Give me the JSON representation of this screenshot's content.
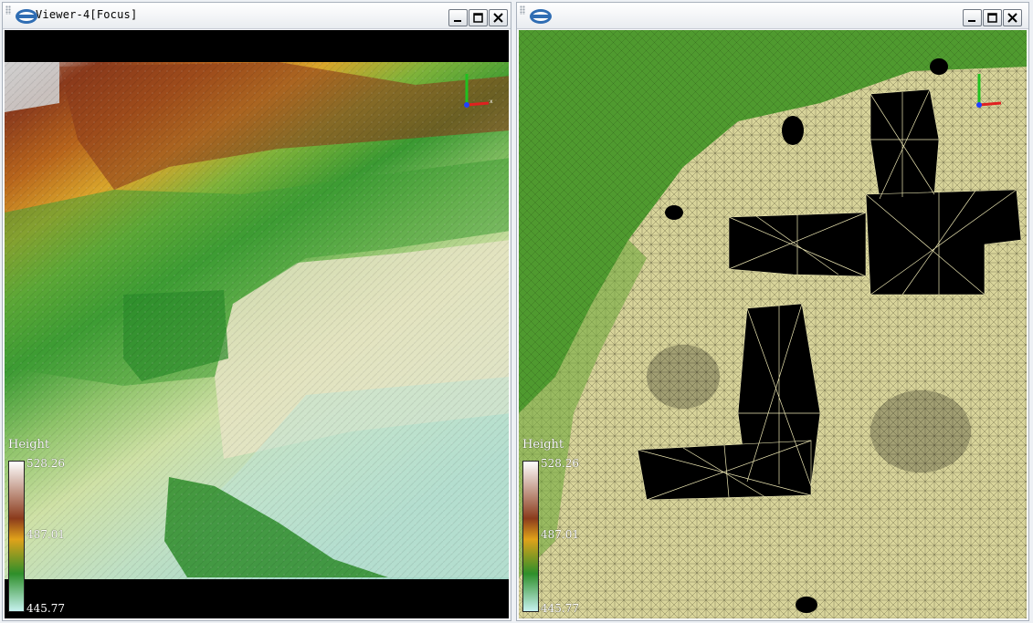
{
  "viewer_left": {
    "title": "Viewer-4[Focus]",
    "buttons": {
      "minimize": "minimize",
      "maximize": "maximize",
      "close": "close"
    },
    "legend": {
      "title": "Height",
      "max": "528.26",
      "mid": "487.01",
      "min": "445.77"
    }
  },
  "viewer_right": {
    "title": "",
    "buttons": {
      "minimize": "minimize",
      "maximize": "maximize",
      "close": "close"
    },
    "legend": {
      "title": "Height",
      "max": "528.26",
      "mid": "487.01",
      "min": "445.77"
    }
  },
  "colors": {
    "legend_gradient": [
      "#ffffff",
      "#8b3b1c",
      "#e0a21a",
      "#2e8f2a",
      "#c7f2ef"
    ],
    "mesh_fill": "#d8d49a",
    "mesh_green": "#4f9a2f",
    "hole": "#000000"
  },
  "icons": [
    "logo-icon",
    "minimize-icon",
    "maximize-icon",
    "close-icon",
    "axis-gizmo-icon"
  ]
}
